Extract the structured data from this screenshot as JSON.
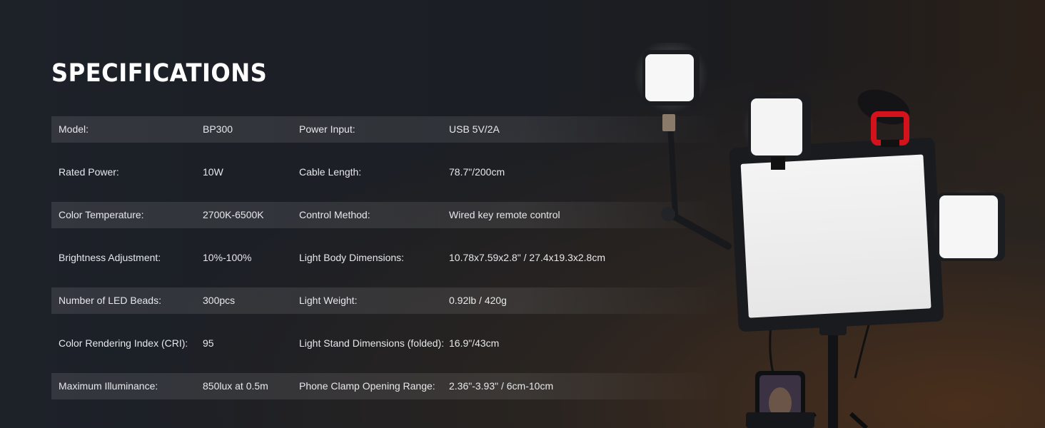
{
  "page": {
    "title": "SPECIFICATIONS"
  },
  "specs": [
    {
      "label1": "Model:",
      "value1": "BP300",
      "label2": "Power Input:",
      "value2": "USB 5V/2A"
    },
    {
      "label1": "Rated Power:",
      "value1": "10W",
      "label2": "Cable Length:",
      "value2": "78.7\"/200cm"
    },
    {
      "label1": "Color Temperature:",
      "value1": "2700K-6500K",
      "label2": "Control Method:",
      "value2": "Wired key remote control"
    },
    {
      "label1": "Brightness Adjustment:",
      "value1": "10%-100%",
      "label2": "Light Body Dimensions:",
      "value2": "10.78x7.59x2.8\" / 27.4x19.3x2.8cm"
    },
    {
      "label1": "Number of LED Beads:",
      "value1": "300pcs",
      "label2": "Light Weight:",
      "value2": "0.92lb / 420g"
    },
    {
      "label1": "Color Rendering Index (CRI):",
      "value1": "95",
      "label2": "Light Stand Dimensions (folded):",
      "value2": "16.9\"/43cm"
    },
    {
      "label1": "Maximum Illuminance:",
      "value1": "850lux at 0.5m",
      "label2": "Phone Clamp Opening Range:",
      "value2": "2.36\"-3.93\" / 6cm-10cm"
    }
  ],
  "colors": {
    "background": "#1d2128",
    "row_shade": "#2f333a",
    "text": "#e6e8eb",
    "title": "#ffffff",
    "mic_accent": "#d4121b"
  }
}
